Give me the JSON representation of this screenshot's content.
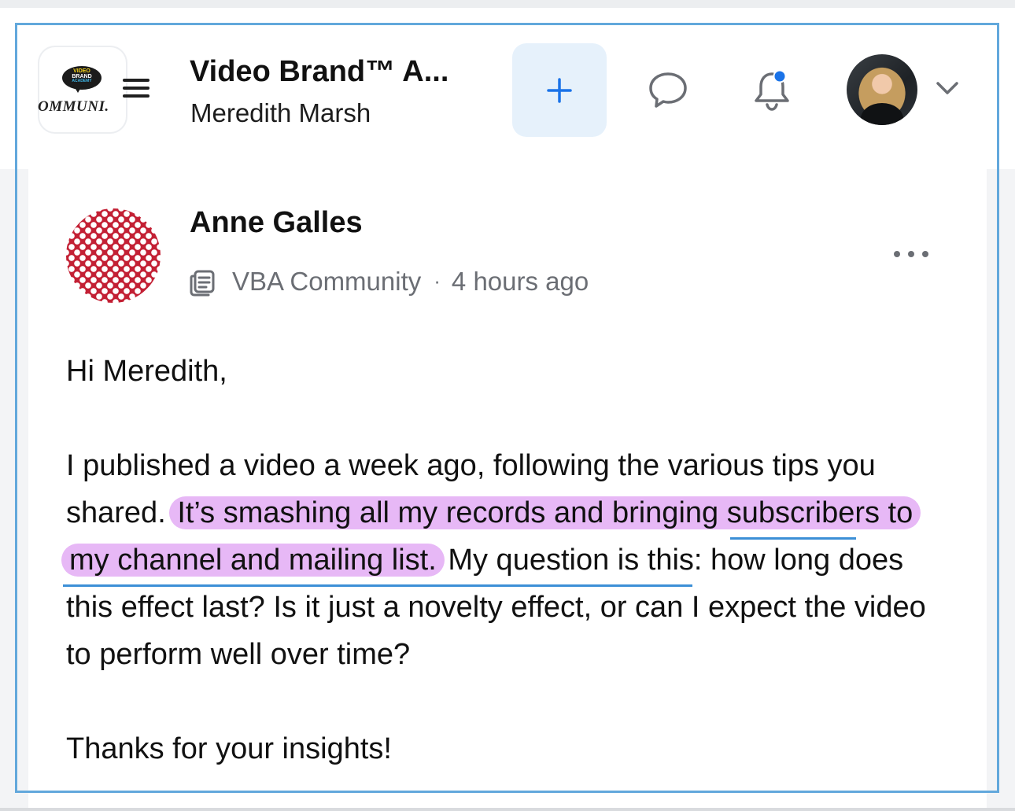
{
  "header": {
    "logo": {
      "badge_lines": [
        "VIDEO",
        "BRAND",
        "ACADEMY"
      ],
      "wordmark": "OMMUNI."
    },
    "title": "Video Brand™ A...",
    "subtitle": "Meredith Marsh",
    "add_button_label": "+",
    "icons": {
      "menu": "hamburger-menu-icon",
      "chat": "chat-bubble-icon",
      "notifications": "bell-icon",
      "account_menu": "chevron-down-icon"
    },
    "notification_dot_color": "#1a73e8"
  },
  "post": {
    "author": "Anne Galles",
    "space_icon": "feed-icon",
    "space": "VBA Community",
    "separator": "·",
    "time": "4 hours ago",
    "greeting": "Hi Meredith,",
    "paragraph_start": "I published a video a week ago, following the various tips you shared.",
    "paragraph_highlight": "It’s smashing all my records and bringing subscribers to my channel and mailing list.",
    "paragraph_end": "My question is this: how long does this effect last? Is it just a novelty effect, or can I expect the video to perform well over time?",
    "closing": "Thanks for your insights!"
  },
  "colors": {
    "highlight": "#e7b8f6",
    "frame": "#62a8dc",
    "accent_button_bg": "#e6f1fb",
    "accent": "#1a73e8",
    "avatar_red": "#c32034"
  }
}
